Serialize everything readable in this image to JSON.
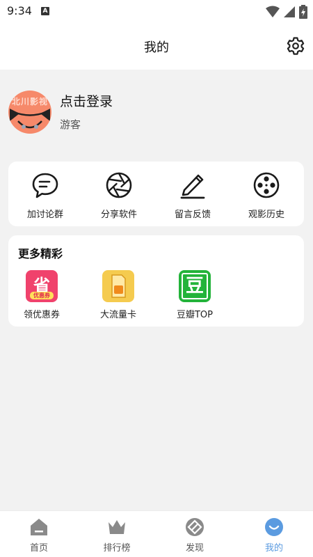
{
  "status_bar": {
    "time": "9:34",
    "notification_icon": "A"
  },
  "header": {
    "title": "我的",
    "settings_icon": "gear-icon"
  },
  "profile": {
    "avatar_text": "北川影视",
    "login_label": "点击登录",
    "subtitle": "游客"
  },
  "actions": [
    {
      "label": "加讨论群",
      "icon": "chat-bubble-icon"
    },
    {
      "label": "分享软件",
      "icon": "aperture-icon"
    },
    {
      "label": "留言反馈",
      "icon": "pencil-icon"
    },
    {
      "label": "观影历史",
      "icon": "film-reel-icon"
    }
  ],
  "more": {
    "title": "更多精彩",
    "apps": [
      {
        "label": "领优惠券",
        "icon": "coupon-icon",
        "icon_text": "省",
        "icon_subtext": "优惠券",
        "color": "#f0426c"
      },
      {
        "label": "大流量卡",
        "icon": "sim-card-icon",
        "color": "#f5cb4f"
      },
      {
        "label": "豆瓣TOP",
        "icon": "douban-icon",
        "icon_text": "豆",
        "color": "#23b33a"
      }
    ]
  },
  "tabbar": {
    "tabs": [
      {
        "label": "首页",
        "icon": "home-icon"
      },
      {
        "label": "排行榜",
        "icon": "crown-icon"
      },
      {
        "label": "发现",
        "icon": "compass-icon"
      },
      {
        "label": "我的",
        "icon": "smile-icon",
        "active": true
      }
    ],
    "active_color": "#5b9be0",
    "inactive_color": "#8a8a8a"
  }
}
